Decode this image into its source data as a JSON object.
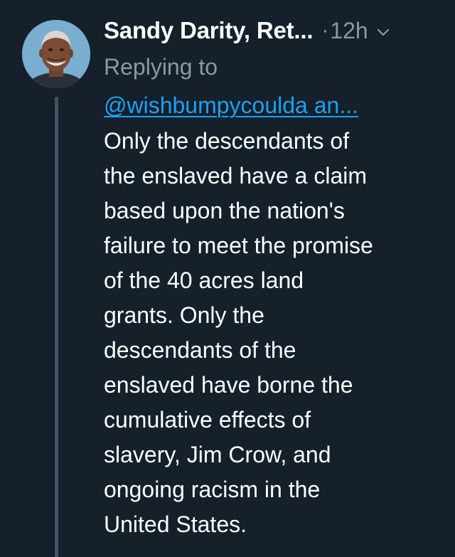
{
  "tweet": {
    "author_name": "Sandy Darity, Ret...",
    "separator": "·",
    "timestamp": "12h",
    "replying_label": "Replying to",
    "reply_to": "@wishbumpycoulda an...",
    "body_lines": [
      "Only the descendants of",
      "the enslaved have a claim",
      "based upon the nation's",
      "failure to meet the promise",
      "of the 40 acres land",
      "grants. Only the",
      "descendants of the",
      "enslaved have borne the",
      "cumulative effects of",
      "slavery, Jim Crow, and",
      "ongoing racism in the",
      "United States."
    ]
  },
  "icons": {
    "avatar": "avatar-photo",
    "menu": "chevron-down-icon"
  },
  "colors": {
    "background": "#15202b",
    "text": "#ffffff",
    "secondary": "#8899a6",
    "link": "#1da1f2",
    "thread_line": "#3d5466"
  }
}
